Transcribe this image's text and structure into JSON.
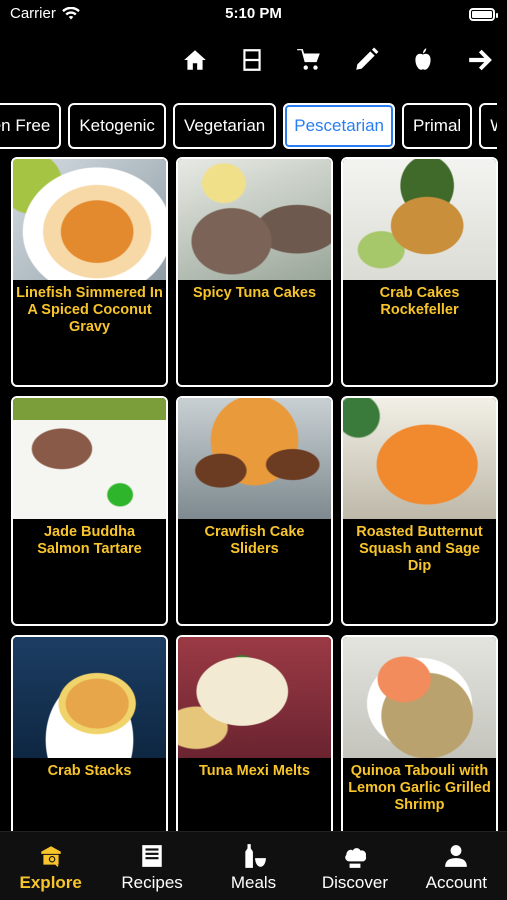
{
  "status": {
    "carrier": "Carrier",
    "time": "5:10 PM"
  },
  "toolbar": [
    {
      "icon": "home-icon"
    },
    {
      "icon": "calculator-icon"
    },
    {
      "icon": "cart-icon"
    },
    {
      "icon": "pencil-icon"
    },
    {
      "icon": "apple-icon"
    },
    {
      "icon": "arrow-right-icon"
    }
  ],
  "filters": {
    "items": [
      "ten Free",
      "Ketogenic",
      "Vegetarian",
      "Pescetarian",
      "Primal",
      "W"
    ],
    "selected": "Pescetarian"
  },
  "recipes": [
    {
      "title": "Linefish Simmered In A Spiced Coconut Gravy"
    },
    {
      "title": "Spicy Tuna Cakes"
    },
    {
      "title": "Crab Cakes Rockefeller"
    },
    {
      "title": "Jade Buddha Salmon Tartare"
    },
    {
      "title": "Crawfish Cake Sliders"
    },
    {
      "title": "Roasted Butternut Squash and Sage Dip"
    },
    {
      "title": "Crab Stacks"
    },
    {
      "title": "Tuna Mexi Melts"
    },
    {
      "title": "Quinoa Tabouli with Lemon Garlic Grilled Shrimp"
    }
  ],
  "tabs": [
    {
      "label": "Explore",
      "icon": "explore-icon",
      "active": true
    },
    {
      "label": "Recipes",
      "icon": "recipes-icon",
      "active": false
    },
    {
      "label": "Meals",
      "icon": "meals-icon",
      "active": false
    },
    {
      "label": "Discover",
      "icon": "chef-hat-icon",
      "active": false
    },
    {
      "label": "Account",
      "icon": "person-icon",
      "active": false
    }
  ],
  "colors": {
    "accent": "#f7c42b",
    "selected_chip": "#2a7ef0",
    "background": "#000000"
  }
}
